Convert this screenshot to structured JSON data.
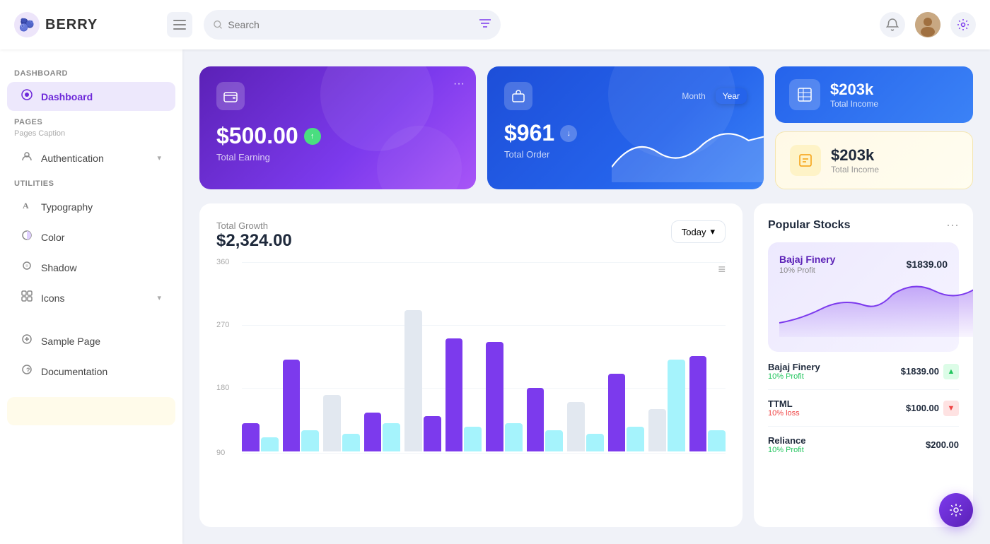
{
  "app": {
    "name": "BERRY",
    "logo_emoji": "🫐"
  },
  "topnav": {
    "search_placeholder": "Search",
    "bell_label": "notifications",
    "gear_label": "settings"
  },
  "sidebar": {
    "section1": "Dashboard",
    "dashboard_item": "Dashboard",
    "section2": "Pages",
    "section2_caption": "Pages Caption",
    "auth_item": "Authentication",
    "section3": "Utilities",
    "typography_item": "Typography",
    "color_item": "Color",
    "shadow_item": "Shadow",
    "icons_item": "Icons",
    "sample_item": "Sample Page",
    "doc_item": "Documentation"
  },
  "earning_card": {
    "amount": "$500.00",
    "label": "Total Earning",
    "menu": "···"
  },
  "order_card": {
    "amount": "$961",
    "label": "Total Order",
    "period_month": "Month",
    "period_year": "Year"
  },
  "income_card_blue": {
    "amount": "$203k",
    "label": "Total Income"
  },
  "income_card_yellow": {
    "amount": "$203k",
    "label": "Total Income"
  },
  "growth_chart": {
    "title": "Total Growth",
    "amount": "$2,324.00",
    "button": "Today",
    "grid_labels": [
      "360",
      "270",
      "180",
      "90"
    ],
    "hamburger": "≡"
  },
  "popular_stocks": {
    "title": "Popular Stocks",
    "menu": "···",
    "featured": {
      "name": "Bajaj Finery",
      "price": "$1839.00",
      "profit": "10% Profit"
    },
    "stocks": [
      {
        "name": "Bajaj Finery",
        "price": "$1839.00",
        "pct": "10% Profit",
        "trend": "up"
      },
      {
        "name": "TTML",
        "price": "$100.00",
        "pct": "10% loss",
        "trend": "down"
      },
      {
        "name": "Reliance",
        "price": "$200.00",
        "pct": "10% Profit",
        "trend": "up"
      }
    ]
  },
  "fab_icon": "⚙"
}
